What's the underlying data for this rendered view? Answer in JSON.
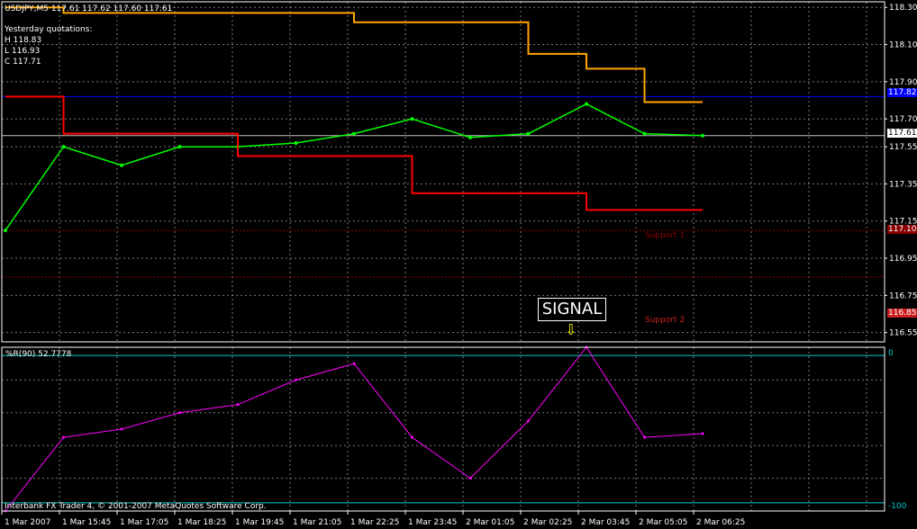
{
  "header": {
    "symbol_line": "USDJPY,M5  117.61 117.62 117.60 117.61",
    "yesterday_title": "Yesterday quotations:",
    "high": "H 118.83",
    "low": "L 116.93",
    "close": "C 117.71"
  },
  "signal": {
    "label": "SIGNAL",
    "arrow": "⇩"
  },
  "levels": {
    "resistance_price_label": "117.82",
    "support1_label": "Support 1",
    "support1_price_label": "117.10",
    "support2_label": "Support 2",
    "support2_price_label": "116.85",
    "current_price_label": "117.61"
  },
  "indicator": {
    "label": "%R(90)  52.7778",
    "top_label": "0",
    "bottom_label": "-100"
  },
  "footer": {
    "copyright": "Interbank FX Trader 4, © 2001-2007 MetaQuotes Software Corp."
  },
  "colors": {
    "background": "#000000",
    "grid": "#7a7a7a",
    "candles": "#00ff00",
    "orange_line": "#ffa500",
    "red_line": "#ff0000",
    "blue_line": "#0000ff",
    "support_line": "#8b0000",
    "current_price_line": "#c0c0c0",
    "indicator_line": "#ff00ff",
    "indicator_level": "#00cccc"
  },
  "chart_data": [
    {
      "type": "line",
      "title": "USDJPY,M5",
      "y_ticks": [
        "118.30",
        "118.10",
        "117.90",
        "117.70",
        "117.55",
        "117.35",
        "117.15",
        "116.95",
        "116.75",
        "116.55"
      ],
      "x_tick_labels": [
        "1 Mar 2007",
        "1 Mar 15:45",
        "1 Mar 17:05",
        "1 Mar 18:25",
        "1 Mar 19:45",
        "1 Mar 21:05",
        "1 Mar 22:25",
        "1 Mar 23:45",
        "2 Mar 01:05",
        "2 Mar 02:25",
        "2 Mar 03:45",
        "2 Mar 05:05",
        "2 Mar 06:25"
      ],
      "ylim": [
        116.5,
        118.33
      ],
      "grid": true,
      "series": [
        {
          "kind": "close_price",
          "x": [
            0,
            1,
            2,
            3,
            4,
            5,
            6,
            7,
            8,
            9,
            10,
            11,
            12
          ],
          "values": [
            117.1,
            117.55,
            117.45,
            117.55,
            117.55,
            117.57,
            117.62,
            117.7,
            117.6,
            117.62,
            117.78,
            117.62,
            117.61
          ]
        },
        {
          "kind": "orange_step",
          "x": [
            0,
            1,
            2,
            3,
            4,
            5,
            6,
            7,
            8,
            9,
            10,
            11,
            12
          ],
          "values": [
            118.3,
            118.27,
            118.27,
            118.27,
            118.27,
            118.27,
            118.22,
            118.22,
            118.22,
            118.05,
            117.97,
            117.79,
            117.79
          ]
        },
        {
          "kind": "red_step",
          "x": [
            0,
            1,
            2,
            3,
            4,
            5,
            6,
            7,
            8,
            9,
            10,
            11,
            12
          ],
          "values": [
            117.82,
            117.62,
            117.62,
            117.62,
            117.5,
            117.5,
            117.5,
            117.3,
            117.3,
            117.3,
            117.21,
            117.21,
            117.21
          ]
        }
      ],
      "levels": [
        {
          "name": "resistance",
          "value": 117.82
        },
        {
          "name": "current",
          "value": 117.61
        },
        {
          "name": "support1",
          "value": 117.1
        },
        {
          "name": "support2",
          "value": 116.85
        }
      ]
    },
    {
      "type": "line",
      "title": "%R(90)",
      "ylim": [
        -100,
        0
      ],
      "levels": [
        -5,
        -95
      ],
      "series": [
        {
          "kind": "williams_r",
          "x": [
            0,
            1,
            2,
            3,
            4,
            5,
            6,
            7,
            8,
            9,
            10,
            11,
            12
          ],
          "values": [
            -100,
            -55,
            -50,
            -40,
            -35,
            -20,
            -10,
            -55,
            -80,
            -45,
            0,
            -55,
            -52.78
          ]
        }
      ]
    }
  ]
}
